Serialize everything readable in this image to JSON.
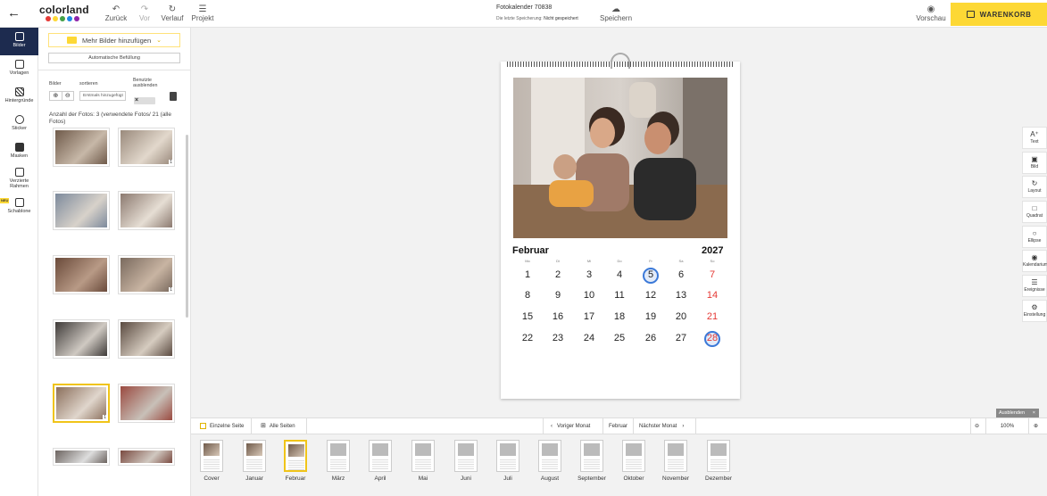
{
  "header": {
    "logo": "colorland",
    "logo_dots": [
      "#e53935",
      "#fdd835",
      "#43a047",
      "#1e88e5",
      "#8e24aa"
    ],
    "undo_label": "Zurück",
    "redo_label": "Vor",
    "history_label": "Verlauf",
    "project_label": "Projekt",
    "doc_title": "Fotokalender 70838",
    "last_save_prefix": "Die letzte Speicherung:",
    "last_save_status": "Nicht gespeichert",
    "save_label": "Speichern",
    "preview_label": "Vorschau",
    "cart_label": "WARENKORB",
    "accent": "#fdd835"
  },
  "tools": [
    {
      "label": "Bilder",
      "icon": "images-icon",
      "active": true
    },
    {
      "label": "Vorlagen",
      "icon": "templates-icon"
    },
    {
      "label": "Hintergründe",
      "icon": "backgrounds-icon"
    },
    {
      "label": "Sticker",
      "icon": "sticker-icon"
    },
    {
      "label": "Masken",
      "icon": "masks-icon"
    },
    {
      "label": "Verzierte Rahmen",
      "icon": "frames-icon"
    },
    {
      "label": "Schablone",
      "icon": "stencil-icon",
      "badge": "NEU"
    }
  ],
  "panel": {
    "add_images_label": "Mehr Bilder hinzufügen",
    "auto_fill_label": "Automatische Befüllung",
    "images_label": "Bilder",
    "sort_label": "sortieren",
    "sort_value": "Erstmals hinzugefügt",
    "hide_used_label": "Benutzte ausblenden",
    "photo_count": "Anzahl der Fotos: 3 (verwendete Fotos/ 21 (alle Fotos)",
    "thumb_counts": [
      "",
      "1",
      "",
      "",
      "",
      "1",
      "",
      "",
      "1",
      ""
    ]
  },
  "calendar": {
    "month": "Februar",
    "year": "2027",
    "weekdays": [
      "Mo",
      "Di",
      "Mi",
      "Do",
      "Fr",
      "Sa",
      "So"
    ],
    "weeks": [
      [
        "1",
        "2",
        "3",
        "4",
        "5",
        "6",
        "7"
      ],
      [
        "8",
        "9",
        "10",
        "11",
        "12",
        "13",
        "14"
      ],
      [
        "15",
        "16",
        "17",
        "18",
        "19",
        "20",
        "21"
      ],
      [
        "22",
        "23",
        "24",
        "25",
        "26",
        "27",
        "28"
      ]
    ],
    "sunday_color": "#e53935",
    "highlight_color": "#3b79d8",
    "highlighted_days": [
      "5",
      "28"
    ]
  },
  "right_tools": [
    {
      "label": "Text",
      "icon": "text-icon"
    },
    {
      "label": "Bild",
      "icon": "image-icon"
    },
    {
      "label": "Layout",
      "icon": "layout-icon"
    },
    {
      "label": "Quadrat",
      "icon": "square-icon"
    },
    {
      "label": "Ellipse",
      "icon": "ellipse-icon"
    },
    {
      "label": "Kalendarium",
      "icon": "calendarium-icon"
    },
    {
      "label": "Ereignisse",
      "icon": "events-icon"
    },
    {
      "label": "Einstellung",
      "icon": "settings-icon"
    }
  ],
  "page_bar": {
    "single_page": "Einzelne Seite",
    "all_pages": "Alle Seiten",
    "prev_month": "Voriger Monat",
    "current_month": "Februar",
    "next_month": "Nächster Monat",
    "zoom": "100%",
    "hide_label": "Ausblenden"
  },
  "months": [
    "Cover",
    "Januar",
    "Februar",
    "März",
    "April",
    "Mai",
    "Juni",
    "Juli",
    "August",
    "September",
    "Oktober",
    "November",
    "Dezember"
  ],
  "selected_month": "Februar"
}
